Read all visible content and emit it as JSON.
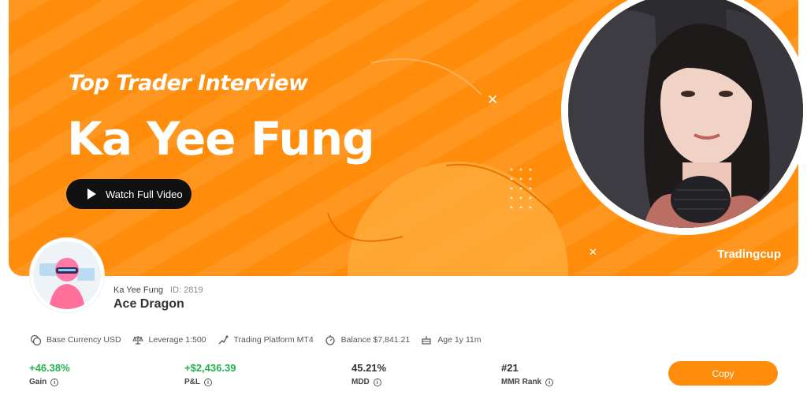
{
  "banner": {
    "subtitle": "Top Trader Interview",
    "title": "Ka Yee Fung",
    "watch_label": "Watch Full Video",
    "brand": "Tradingcup"
  },
  "profile": {
    "name": "Ka Yee Fung",
    "id": "ID: 2819",
    "nickname": "Ace Dragon"
  },
  "meta": [
    {
      "icon": "currency-icon",
      "text": "Base Currency USD"
    },
    {
      "icon": "scale-icon",
      "text": "Leverage 1:500"
    },
    {
      "icon": "platform-icon",
      "text": "Trading Platform MT4"
    },
    {
      "icon": "balance-icon",
      "text": "Balance $7,841.21"
    },
    {
      "icon": "age-icon",
      "text": "Age 1y 11m"
    }
  ],
  "stats": [
    {
      "value": "+46.38%",
      "label": "Gain",
      "color": "#1fb34a"
    },
    {
      "value": "+$2,436.39",
      "label": "P&L",
      "color": "#1fb34a"
    },
    {
      "value": "45.21%",
      "label": "MDD",
      "color": "#333333"
    },
    {
      "value": "#21",
      "label": "MMR Rank",
      "color": "#333333"
    }
  ],
  "copy_label": "Copy",
  "colors": {
    "accent": "#ff8c0a",
    "positive": "#1fb34a"
  }
}
